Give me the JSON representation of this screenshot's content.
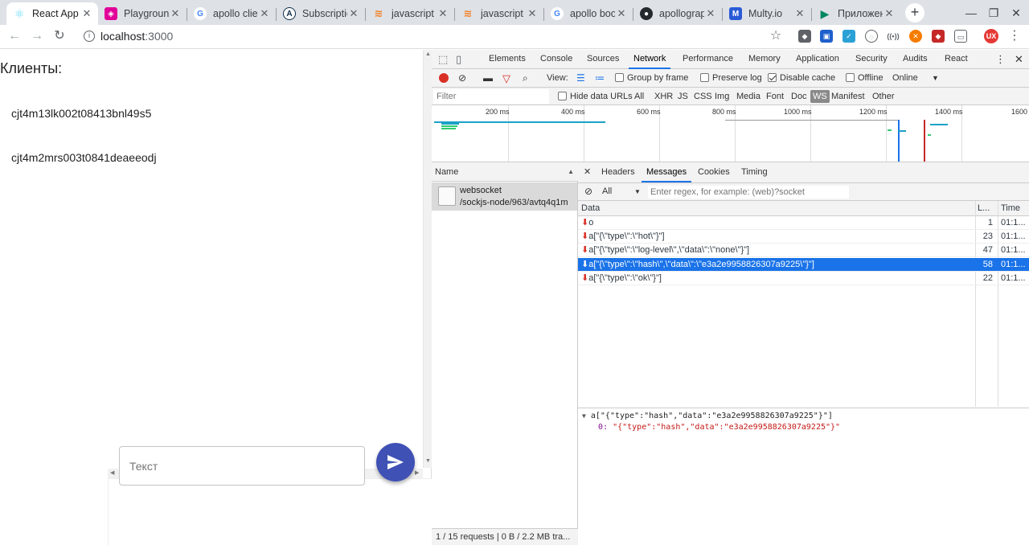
{
  "browser": {
    "tabs": [
      {
        "title": "React App",
        "icon": "react-icon",
        "active": true
      },
      {
        "title": "Playground",
        "icon": "graphql-playground-icon"
      },
      {
        "title": "apollo client",
        "icon": "google-icon"
      },
      {
        "title": "Subscriptio",
        "icon": "apollo-icon"
      },
      {
        "title": "javascript -",
        "icon": "stackoverflow-icon"
      },
      {
        "title": "javascript -",
        "icon": "stackoverflow-icon"
      },
      {
        "title": "apollo boos",
        "icon": "google-icon"
      },
      {
        "title": "apollograph",
        "icon": "github-icon"
      },
      {
        "title": "Multy.io",
        "icon": "multy-icon"
      },
      {
        "title": "Приложен",
        "icon": "play-store-icon"
      }
    ],
    "url_host": "localhost",
    "url_port": ":3000"
  },
  "page": {
    "title": "Клиенты:",
    "clients": [
      "cjt4m13lk002t08413bnl49s5",
      "cjt4m2mrs003t0841deaeeodj"
    ],
    "input_placeholder": "Текст"
  },
  "devtools": {
    "tabs": [
      "Elements",
      "Console",
      "Sources",
      "Network",
      "Performance",
      "Memory",
      "Application",
      "Security",
      "Audits",
      "React"
    ],
    "active_tab": "Network",
    "toolbar": {
      "view_label": "View:",
      "group_by_frame": "Group by frame",
      "preserve_log": "Preserve log",
      "disable_cache": "Disable cache",
      "offline": "Offline",
      "throttle": "Online"
    },
    "filter": {
      "placeholder": "Filter",
      "hide_data_urls": "Hide data URLs",
      "types": [
        "All",
        "XHR",
        "JS",
        "CSS",
        "Img",
        "Media",
        "Font",
        "Doc",
        "WS",
        "Manifest",
        "Other"
      ]
    },
    "timeline_labels": [
      "200 ms",
      "400 ms",
      "600 ms",
      "800 ms",
      "1000 ms",
      "1200 ms",
      "1400 ms",
      "1600"
    ],
    "requests": {
      "header": "Name",
      "items": [
        {
          "name": "websocket",
          "path": "/sockjs-node/963/avtq4q1m"
        }
      ],
      "status": "1 / 15 requests  |  0 B / 2.2 MB tra..."
    },
    "detail": {
      "tabs": [
        "Headers",
        "Messages",
        "Cookies",
        "Timing"
      ],
      "active_tab": "Messages",
      "filter_all": "All",
      "regex_placeholder": "Enter regex, for example: (web)?socket",
      "columns": {
        "data": "Data",
        "length": "L...",
        "time": "Time"
      },
      "messages": [
        {
          "data": "o",
          "length": "1",
          "time": "01:1..."
        },
        {
          "data": "a[\"{\\\"type\\\":\\\"hot\\\"}\"]",
          "length": "23",
          "time": "01:1..."
        },
        {
          "data": "a[\"{\\\"type\\\":\\\"log-level\\\",\\\"data\\\":\\\"none\\\"}\"]",
          "length": "47",
          "time": "01:1..."
        },
        {
          "data": "a[\"{\\\"type\\\":\\\"hash\\\",\\\"data\\\":\\\"e3a2e9958826307a9225\\\"}\"]",
          "length": "58",
          "time": "01:1...",
          "selected": true
        },
        {
          "data": "a[\"{\\\"type\\\":\\\"ok\\\"}\"]",
          "length": "22",
          "time": "01:1..."
        }
      ],
      "preview_root": "a[\"{\"type\":\"hash\",\"data\":\"e3a2e9958826307a9225\"}\"]",
      "preview_key": "0:",
      "preview_value": "\"{\"type\":\"hash\",\"data\":\"e3a2e9958826307a9225\"}\""
    }
  },
  "colors": {
    "accent": "#1a73e8",
    "send_button": "#3f51b5",
    "record": "#d93025"
  }
}
